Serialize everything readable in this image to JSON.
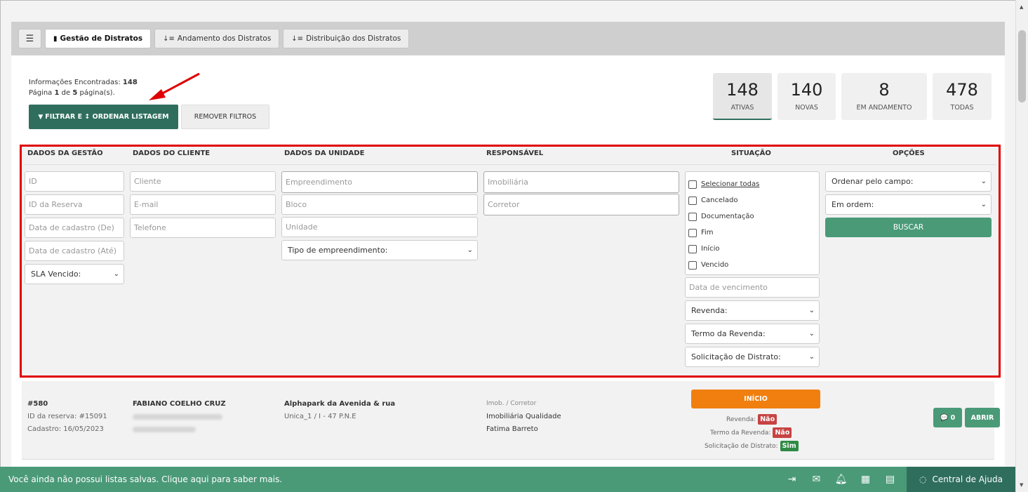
{
  "tabs": {
    "menu_icon": "hamburger-icon",
    "items": [
      {
        "label": "Gestão de Distratos",
        "icon": "bookmark-icon",
        "active": true
      },
      {
        "label": "Andamento dos Distratos",
        "icon": "sort-icon",
        "active": false
      },
      {
        "label": "Distribuição dos Distratos",
        "icon": "sort-icon",
        "active": false
      }
    ]
  },
  "info": {
    "found_label": "Informações Encontradas:",
    "found_count": "148",
    "page_label": "Página",
    "page_current": "1",
    "page_of": "de",
    "page_total": "5",
    "page_suffix": "página(s)."
  },
  "actions": {
    "filter_label": "FILTRAR E ↕ ORDENAR LISTAGEM",
    "remove_label": "REMOVER FILTROS"
  },
  "stats": [
    {
      "value": "148",
      "label": "ATIVAS",
      "active": true
    },
    {
      "value": "140",
      "label": "NOVAS",
      "active": false
    },
    {
      "value": "8",
      "label": "EM ANDAMENTO",
      "active": false
    },
    {
      "value": "478",
      "label": "TODAS",
      "active": false
    }
  ],
  "filters": {
    "headers": {
      "gestao": "DADOS DA GESTÃO",
      "cliente": "DADOS DO CLIENTE",
      "unidade": "DADOS DA UNIDADE",
      "responsavel": "RESPONSÁVEL",
      "situacao": "SITUAÇÃO",
      "opcoes": "OPÇÕES"
    },
    "gestao": {
      "id": "ID",
      "reserva": "ID da Reserva",
      "data_de": "Data de cadastro (De)",
      "data_ate": "Data de cadastro (Até)",
      "sla": "SLA Vencido:"
    },
    "cliente": {
      "cliente": "Cliente",
      "email": "E-mail",
      "telefone": "Telefone"
    },
    "unidade": {
      "empreendimento": "Empreendimento",
      "bloco": "Bloco",
      "unidade": "Unidade",
      "tipo": "Tipo de empreendimento:"
    },
    "responsavel": {
      "imobiliaria": "Imobiliária",
      "corretor": "Corretor"
    },
    "situacao": {
      "checks": [
        "Selecionar todas",
        "Cancelado",
        "Documentação",
        "Fim",
        "Início",
        "Vencido"
      ],
      "vencimento": "Data de vencimento",
      "revenda": "Revenda:",
      "termo": "Termo da Revenda:",
      "solicitacao": "Solicitação de Distrato:"
    },
    "opcoes": {
      "ordenar": "Ordenar pelo campo:",
      "ordem": "Em ordem:",
      "buscar": "BUSCAR"
    }
  },
  "record": {
    "id": "#580",
    "reserva": "ID da reserva: #15091",
    "cadastro": "Cadastro: 16/05/2023",
    "cliente": "FABIANO COELHO CRUZ",
    "empreendimento": "Alphapark da Avenida & rua",
    "unidade": "Unica_1 / I - 47 P.N.E",
    "imob_label": "Imob. / Corretor",
    "imobiliaria": "Imobiliária Qualidade",
    "corretor": "Fatima Barreto",
    "status": "INÍCIO",
    "revenda_label": "Revenda:",
    "revenda_value": "Não",
    "termo_label": "Termo da Revenda:",
    "termo_value": "Não",
    "solicitacao_label": "Solicitação de Distrato:",
    "solicitacao_value": "Sim",
    "chat_count": "0",
    "abrir": "ABRIR"
  },
  "bottom": {
    "message": "Você ainda não possui listas salvas. Clique aqui para saber mais.",
    "help": "Central de Ajuda"
  },
  "colors": {
    "primary_dark": "#2f6e5d",
    "primary": "#4a9a78",
    "status_orange": "#f07f0f",
    "badge_no": "#c74343",
    "badge_yes": "#2f8a45",
    "highlight_red": "#e00000"
  }
}
